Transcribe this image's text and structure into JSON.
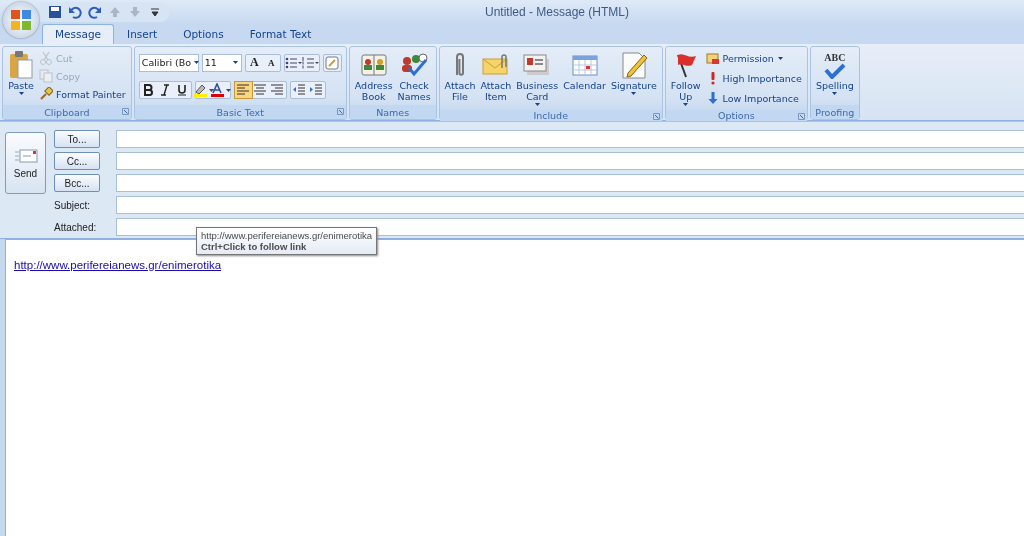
{
  "window": {
    "title": "Untitled - Message (HTML)"
  },
  "tabs": [
    {
      "label": "Message",
      "selected": true
    },
    {
      "label": "Insert",
      "selected": false
    },
    {
      "label": "Options",
      "selected": false
    },
    {
      "label": "Format Text",
      "selected": false
    }
  ],
  "ribbon": {
    "clipboard": {
      "title": "Clipboard",
      "paste": "Paste",
      "small": [
        {
          "label": "Cut",
          "disabled": true
        },
        {
          "label": "Copy",
          "disabled": true
        },
        {
          "label": "Format Painter",
          "disabled": false
        }
      ]
    },
    "basic_text": {
      "title": "Basic Text",
      "font": "Calibri (Bo",
      "size": "11",
      "grow_glyph": "A",
      "shrink_glyph": "A",
      "align": [
        {
          "selected": true
        },
        {
          "selected": false
        },
        {
          "selected": false
        }
      ]
    },
    "names": {
      "title": "Names",
      "buttons": [
        {
          "lines": [
            "Address",
            "Book"
          ],
          "has_menu": false
        },
        {
          "lines": [
            "Check",
            "Names"
          ],
          "has_menu": false
        }
      ]
    },
    "include": {
      "title": "Include",
      "buttons": [
        {
          "lines": [
            "Attach",
            "File"
          ],
          "has_menu": false
        },
        {
          "lines": [
            "Attach",
            "Item"
          ],
          "has_menu": false
        },
        {
          "lines": [
            "Business",
            "Card"
          ],
          "has_menu": true
        },
        {
          "lines": [
            "Calendar"
          ],
          "has_menu": false
        },
        {
          "lines": [
            "Signature"
          ],
          "has_menu": true
        }
      ]
    },
    "options": {
      "title": "Options",
      "follow_up": {
        "lines": [
          "Follow",
          "Up"
        ],
        "has_menu": true
      },
      "small": [
        {
          "label": "Permission",
          "has_menu": true
        },
        {
          "label": "High Importance",
          "has_menu": false
        },
        {
          "label": "Low Importance",
          "has_menu": false
        }
      ]
    },
    "proofing": {
      "title": "Proofing",
      "icon_text": "ABC",
      "button": {
        "lines": [
          "Spelling"
        ],
        "has_menu": true
      }
    }
  },
  "header": {
    "send": "Send",
    "address_buttons": [
      "To...",
      "Cc...",
      "Bcc..."
    ],
    "labels": [
      "Subject:",
      "Attached:"
    ]
  },
  "body": {
    "link": "http://www.perifereianews.gr/enimerotika"
  },
  "tooltip": {
    "lines": [
      "http://www.perifereianews.gr/enimerotika",
      "Ctrl+Click to follow link"
    ]
  }
}
